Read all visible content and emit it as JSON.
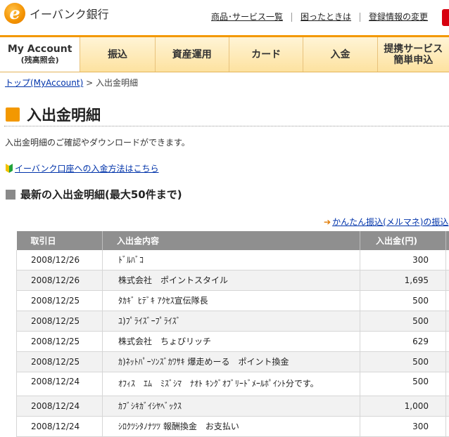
{
  "header": {
    "logo_letter": "e",
    "logo_text": "イーバンク銀行",
    "util_links": [
      "商品･サービス一覧",
      "困ったときは",
      "登録情報の変更"
    ]
  },
  "nav": {
    "active": {
      "line1": "My Account",
      "line2": "(残高照会)"
    },
    "items": [
      {
        "label": "振込"
      },
      {
        "label": "資産運用"
      },
      {
        "label": "カード"
      },
      {
        "label": "入金"
      },
      {
        "label1": "提携サービス",
        "label2": "簡単申込"
      }
    ]
  },
  "breadcrumb": {
    "home": "トップ(MyAccount)",
    "sep": " > ",
    "current": "入出金明細"
  },
  "page": {
    "title": "入出金明細",
    "description": "入出金明細のご確認やダウンロードができます。",
    "deposit_link": "イーバンク口座への入金方法はこちら",
    "section_title": "最新の入出金明細(最大50件まで)",
    "right_link": "かんたん振込(メルマネ)の振込"
  },
  "table": {
    "headers": [
      "取引日",
      "入出金内容",
      "入出金(円)"
    ],
    "rows": [
      {
        "date": "2008/12/26",
        "desc": "ﾄﾞﾙﾊﾞｺ",
        "amount": "300"
      },
      {
        "date": "2008/12/26",
        "desc": "株式会社　ポイントスタイル",
        "amount": "1,695"
      },
      {
        "date": "2008/12/25",
        "desc": "ﾀｶｷﾞ ﾋﾃﾞｷ ｱｸｾｽ宣伝隊長",
        "amount": "500"
      },
      {
        "date": "2008/12/25",
        "desc": "ﾕ)ﾌﾟﾗｲｽﾞｰﾌﾟﾗｲｽﾞ",
        "amount": "500"
      },
      {
        "date": "2008/12/25",
        "desc": "株式会社　ちょびリッチ",
        "amount": "629"
      },
      {
        "date": "2008/12/25",
        "desc": "ｶ)ﾈｯﾄﾊﾟｰｿﾝｽﾞｶﾜｻｷ 爆走めーる　ポイント換金",
        "amount": "500"
      },
      {
        "date": "2008/12/24",
        "desc": "ｵﾌｨｽ　ｴﾑ　ﾐｽﾞｼﾏ　ﾅｵﾄ ｷﾝｸﾞｵﾌﾞﾘｰﾄﾞﾒｰﾙﾎﾟｲﾝﾄ分です。",
        "amount": "500"
      },
      {
        "date": "2008/12/24",
        "desc": "ｶﾌﾞｼｷｶﾞｲｼﾔﾍﾞｯｸｽ",
        "amount": "1,000"
      },
      {
        "date": "2008/12/24",
        "desc": "ｼﾛｸﾂｼﾀﾉﾅﾂﾂ 報酬換金　お支払い",
        "amount": "300"
      }
    ]
  },
  "colors": {
    "accent": "#f39800",
    "header_bg": "#8f8f8f",
    "link": "#0033aa",
    "brand_red": "#d7000f"
  }
}
